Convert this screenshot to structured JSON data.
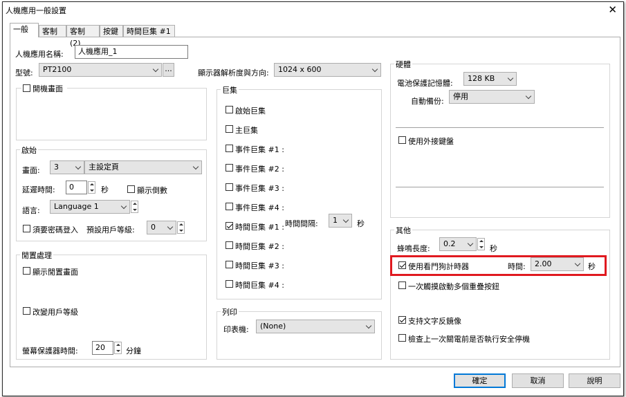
{
  "window": {
    "title": "人機應用一般設置",
    "close_symbol": "✕"
  },
  "tabs": [
    {
      "label": "一般"
    },
    {
      "label": "客制"
    },
    {
      "label": "客制 (2)"
    },
    {
      "label": "按鍵"
    },
    {
      "label": "時間巨集 #1"
    }
  ],
  "general": {
    "name_label": "人機應用名稱:",
    "name_value": "人機應用_1",
    "model_label": "型號:",
    "model_value": "PT2100",
    "model_browse": "...",
    "resolution_label": "顯示器解析度與方向:",
    "resolution_value": "1024 x 600",
    "startup_screen_label": "開機畫面"
  },
  "startup": {
    "group_title": "啟始",
    "screen_label": "畫面:",
    "screen_number": "3",
    "screen_name": "主設定頁",
    "delay_label": "延遲時間:",
    "delay_value": "0",
    "delay_unit": "秒",
    "show_countdown_label": "顯示倒數",
    "language_label": "語言:",
    "language_value": "Language 1",
    "require_password_label": "須要密碼登入",
    "default_user_level_label": "預設用戶等級:",
    "default_user_level_value": "0"
  },
  "idle": {
    "group_title": "閒置處理",
    "show_idle_screen_label": "顯示閒置畫面",
    "change_user_level_label": "改變用戶等級",
    "screensaver_label": "螢幕保護器時間:",
    "screensaver_value": "20",
    "screensaver_unit": "分鐘"
  },
  "macros": {
    "group_title": "巨集",
    "items": [
      {
        "label": "啟始巨集",
        "checked": false
      },
      {
        "label": "主巨集",
        "checked": false
      },
      {
        "label": "事件巨集 #1 :",
        "checked": false
      },
      {
        "label": "事件巨集 #2 :",
        "checked": false
      },
      {
        "label": "事件巨集 #3 :",
        "checked": false
      },
      {
        "label": "事件巨集 #4 :",
        "checked": false
      },
      {
        "label": "時間巨集 #1 :",
        "checked": true
      },
      {
        "label": "時間巨集 #2 :",
        "checked": false
      },
      {
        "label": "時間巨集 #3 :",
        "checked": false
      },
      {
        "label": "時間巨集 #4 :",
        "checked": false
      }
    ],
    "interval_label": "時間間隔:",
    "interval_value": "1",
    "interval_unit": "秒"
  },
  "print": {
    "group_title": "列印",
    "printer_label": "印表機:",
    "printer_value": "(None)"
  },
  "hardware": {
    "group_title": "硬體",
    "battery_memory_label": "電池保護記憶體:",
    "battery_memory_value": "128 KB",
    "auto_backup_label": "自動備份:",
    "auto_backup_value": "停用",
    "external_keyboard_label": "使用外接鍵盤"
  },
  "other": {
    "group_title": "其他",
    "buzzer_label": "蜂鳴長度:",
    "buzzer_value": "0.2",
    "buzzer_unit": "秒",
    "watchdog_label": "使用看門狗計時器",
    "watchdog_checked": true,
    "watchdog_time_label": "時間:",
    "watchdog_time_value": "2.00",
    "watchdog_time_unit": "秒",
    "multi_touch_label": "一次觸摸啟動多個重疊按鈕",
    "multi_touch_checked": false,
    "text_mirror_label": "支持文字反鏡像",
    "text_mirror_checked": true,
    "safe_shutdown_label": "檢查上一次關電前是否執行安全停機",
    "safe_shutdown_checked": false
  },
  "footer": {
    "ok_label": "確定",
    "cancel_label": "取消",
    "help_label": "說明"
  },
  "colors": {
    "highlight_box": "#e0191f",
    "default_button_border": "#0078d7"
  }
}
